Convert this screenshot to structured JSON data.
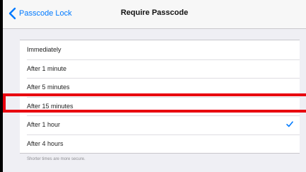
{
  "navbar": {
    "back_label": "Passcode Lock",
    "title": "Require Passcode"
  },
  "options": [
    {
      "label": "Immediately",
      "selected": false
    },
    {
      "label": "After 1 minute",
      "selected": false
    },
    {
      "label": "After 5 minutes",
      "selected": false
    },
    {
      "label": "After 15 minutes",
      "selected": false
    },
    {
      "label": "After 1 hour",
      "selected": true
    },
    {
      "label": "After 4 hours",
      "selected": false
    }
  ],
  "footer_note": "Shorter times are more secure.",
  "colors": {
    "accent": "#007aff",
    "highlight": "#e8000f",
    "background": "#efeff4"
  },
  "icons": {
    "back": "chevron-left-icon",
    "selected": "checkmark-icon"
  }
}
